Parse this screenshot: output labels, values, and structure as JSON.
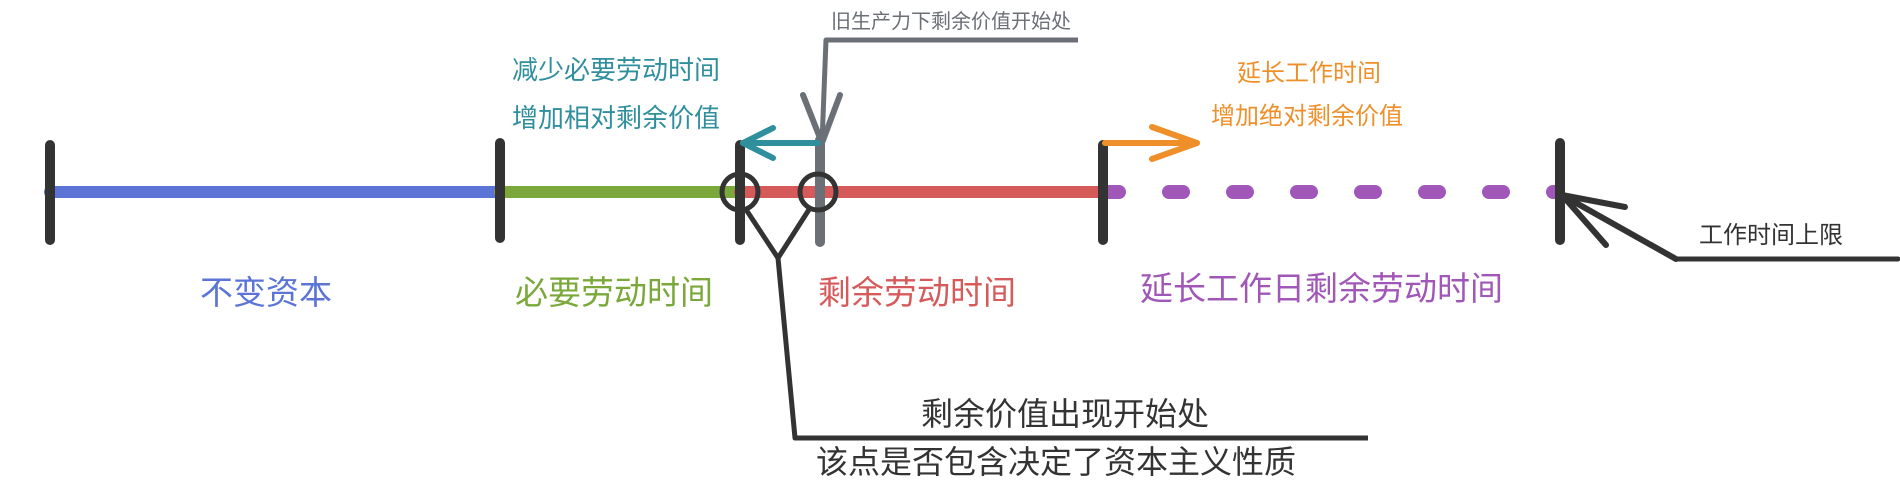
{
  "segments": {
    "constant_capital": "不变资本",
    "necessary_labor": "必要劳动时间",
    "surplus_labor": "剩余劳动时间",
    "extended_surplus": "延长工作日剩余劳动时间"
  },
  "annotations": {
    "old_productivity_start": "旧生产力下剩余价值开始处",
    "relative_line1": "减少必要劳动时间",
    "relative_line2": "增加相对剩余价值",
    "absolute_line1": "延长工作时间",
    "absolute_line2": "增加绝对剩余价值",
    "workday_limit": "工作时间上限",
    "surplus_start_line1": "剩余价值出现开始处",
    "surplus_start_line2": "该点是否包含决定了资本主义性质"
  },
  "colors": {
    "constant_capital": "#5b74d6",
    "necessary_labor": "#7aa83a",
    "surplus_labor": "#d65a5a",
    "extended_surplus": "#a057b8",
    "relative_arrow": "#2f8f9d",
    "absolute_arrow": "#ef8f2a",
    "old_marker": "#6b6f76",
    "ink": "#333333"
  }
}
